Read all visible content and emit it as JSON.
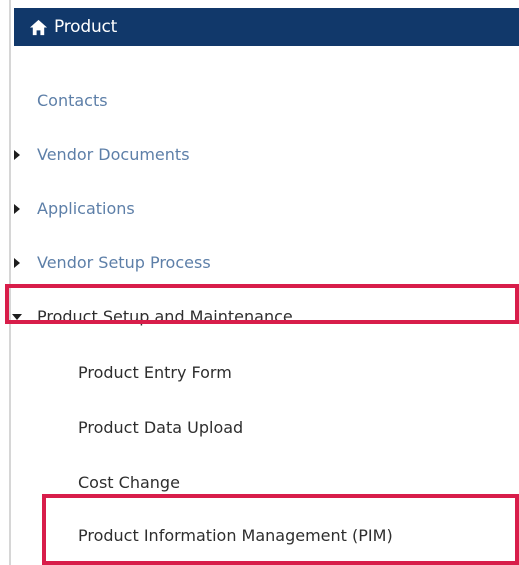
{
  "header": {
    "title": "Product",
    "icon": "home-icon",
    "background_color": "#11386a"
  },
  "nav": {
    "items": [
      {
        "label": "Contacts",
        "expandable": false
      },
      {
        "label": "Vendor Documents",
        "expandable": true,
        "expanded": false
      },
      {
        "label": "Applications",
        "expandable": true,
        "expanded": false
      },
      {
        "label": "Vendor Setup Process",
        "expandable": true,
        "expanded": false
      },
      {
        "label": "Product Setup and Maintenance",
        "expandable": true,
        "expanded": true,
        "children": [
          {
            "label": "Product Entry Form"
          },
          {
            "label": "Product Data Upload"
          },
          {
            "label": "Cost Change"
          },
          {
            "label": "Product Information Management (PIM)"
          }
        ]
      }
    ]
  },
  "colors": {
    "link_blue": "#5d7fa8",
    "text_dark": "#2e2e2e",
    "highlight": "#d81d4a"
  }
}
